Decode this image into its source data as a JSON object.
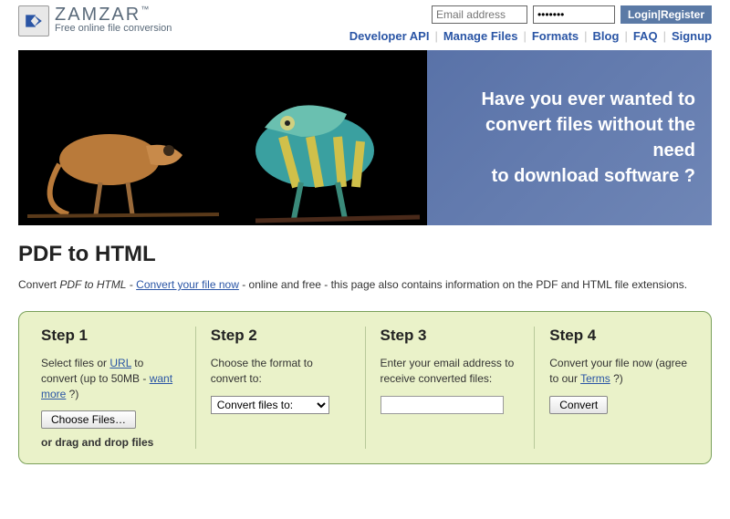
{
  "logo": {
    "title": "ZAMZAR",
    "tm": "™",
    "tagline": "Free online file conversion"
  },
  "login": {
    "email_placeholder": "Email address",
    "password_value": "•••••••",
    "login_label": "Login",
    "sep": " | ",
    "register_label": "Register"
  },
  "nav": {
    "items": [
      "Developer API",
      "Manage Files",
      "Formats",
      "Blog",
      "FAQ",
      "Signup"
    ]
  },
  "hero": {
    "line1": "Have you ever wanted to",
    "line2": "convert files without the need",
    "line3": "to download software ?"
  },
  "page_title": "PDF to HTML",
  "desc": {
    "pre": "Convert ",
    "em": "PDF to HTML",
    "mid": " - ",
    "link": "Convert your file now",
    "post": " - online and free - this page also contains information on the PDF and HTML file extensions."
  },
  "steps": {
    "s1": {
      "title": "Step 1",
      "text_pre": "Select files or ",
      "url_link": "URL",
      "text_mid": " to convert (up to 50MB - ",
      "more_link": "want more",
      "text_post": " ?)",
      "button": "Choose Files…",
      "drag": "or drag and drop files"
    },
    "s2": {
      "title": "Step 2",
      "text": "Choose the format to convert to:",
      "select_label": "Convert files to:"
    },
    "s3": {
      "title": "Step 3",
      "text": "Enter your email address to receive converted files:"
    },
    "s4": {
      "title": "Step 4",
      "text_pre": "Convert your file now (agree to our ",
      "terms_link": "Terms",
      "text_post": " ?)",
      "button": "Convert"
    }
  }
}
